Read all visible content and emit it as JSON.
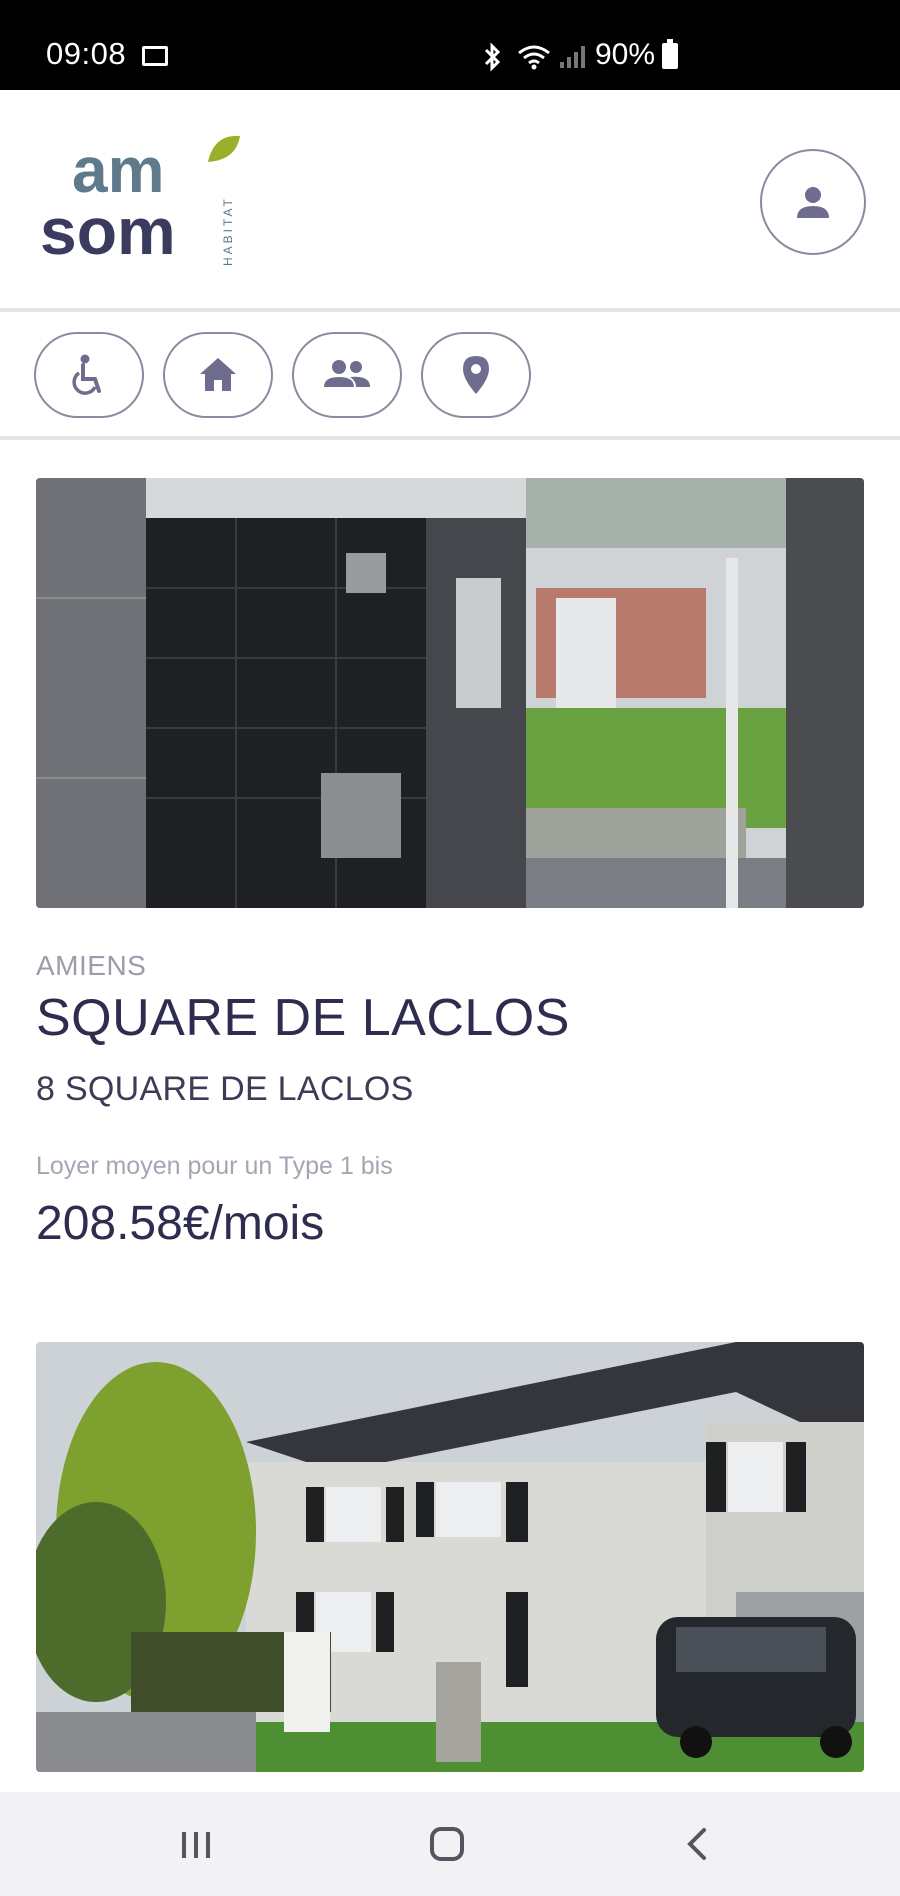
{
  "status_bar": {
    "time": "09:08",
    "battery": "90%",
    "icons": [
      "gallery-icon",
      "bluetooth-icon",
      "wifi-icon",
      "signal-icon",
      "battery-icon"
    ]
  },
  "header": {
    "logo": {
      "text_line1": "am",
      "text_line2": "som",
      "subtext": "HABITAT"
    },
    "profile_icon": "user-icon"
  },
  "filters": [
    {
      "name": "accessibility",
      "icon": "wheelchair-icon"
    },
    {
      "name": "housing",
      "icon": "home-icon"
    },
    {
      "name": "people",
      "icon": "group-icon"
    },
    {
      "name": "location",
      "icon": "location-pin-icon"
    }
  ],
  "listings": [
    {
      "city": "AMIENS",
      "title": "SQUARE DE LACLOS",
      "address": "8 SQUARE DE LACLOS",
      "rent_label": "Loyer moyen pour un Type 1 bis",
      "rent_value": "208.58€/mois"
    }
  ],
  "nav": {
    "icons": [
      "recent-apps-icon",
      "home-icon",
      "back-icon"
    ]
  },
  "colors": {
    "primary": "#2e2d4f",
    "logo_blue": "#5f7b8b",
    "logo_dark": "#3b3a5f",
    "leaf": "#9bb02a",
    "border": "#8c8a9f"
  }
}
